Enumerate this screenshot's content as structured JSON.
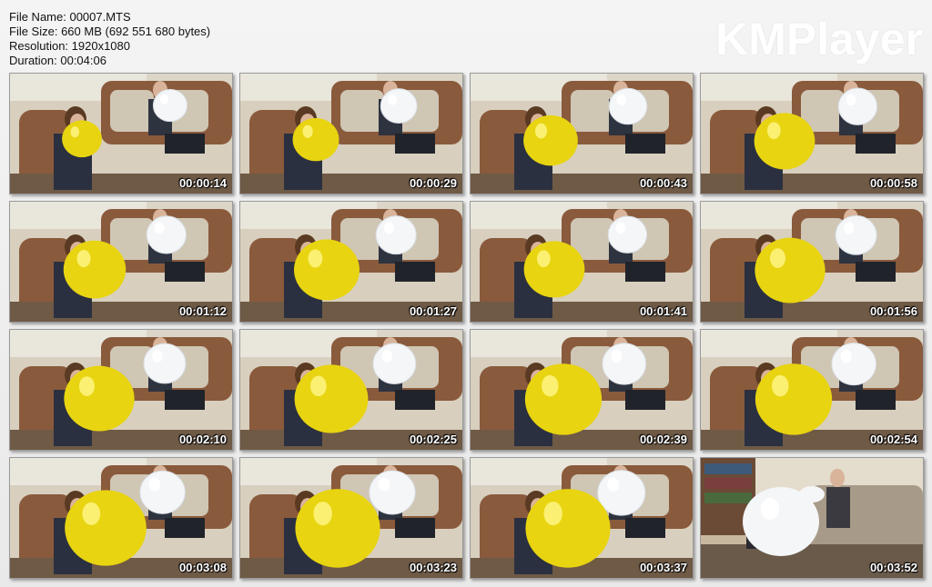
{
  "file_info": {
    "name": "File Name: 00007.MTS",
    "size": "File Size: 660 MB (692 551 680 bytes)",
    "resolution": "Resolution: 1920x1080",
    "duration": "Duration: 00:04:06"
  },
  "logo": "KMPlayer",
  "thumbnails": [
    {
      "time": "00:00:14",
      "yellow": 0.18,
      "white": 0.3,
      "scene": "sofa"
    },
    {
      "time": "00:00:29",
      "yellow": 0.26,
      "white": 0.36,
      "scene": "sofa"
    },
    {
      "time": "00:00:43",
      "yellow": 0.36,
      "white": 0.4,
      "scene": "sofa"
    },
    {
      "time": "00:00:58",
      "yellow": 0.44,
      "white": 0.42,
      "scene": "sofa"
    },
    {
      "time": "00:01:12",
      "yellow": 0.46,
      "white": 0.44,
      "scene": "sofa"
    },
    {
      "time": "00:01:27",
      "yellow": 0.5,
      "white": 0.46,
      "scene": "sofa"
    },
    {
      "time": "00:01:41",
      "yellow": 0.44,
      "white": 0.42,
      "scene": "sofa"
    },
    {
      "time": "00:01:56",
      "yellow": 0.56,
      "white": 0.48,
      "scene": "sofa"
    },
    {
      "time": "00:02:10",
      "yellow": 0.56,
      "white": 0.5,
      "scene": "sofa"
    },
    {
      "time": "00:02:25",
      "yellow": 0.6,
      "white": 0.52,
      "scene": "sofa"
    },
    {
      "time": "00:02:39",
      "yellow": 0.64,
      "white": 0.54,
      "scene": "sofa"
    },
    {
      "time": "00:02:54",
      "yellow": 0.64,
      "white": 0.56,
      "scene": "sofa"
    },
    {
      "time": "00:03:08",
      "yellow": 0.7,
      "white": 0.58,
      "scene": "sofa"
    },
    {
      "time": "00:03:23",
      "yellow": 0.74,
      "white": 0.6,
      "scene": "sofa"
    },
    {
      "time": "00:03:37",
      "yellow": 0.74,
      "white": 0.64,
      "scene": "sofa"
    },
    {
      "time": "00:03:52",
      "yellow": 0.0,
      "white": 0.8,
      "scene": "room"
    }
  ],
  "colors": {
    "yellow_balloon": "#e8d410",
    "white_balloon": "#f4f6f8",
    "sofa": "#8a5a3c",
    "cushion": "#d8cfbe",
    "wall": "#e9e6dc"
  }
}
